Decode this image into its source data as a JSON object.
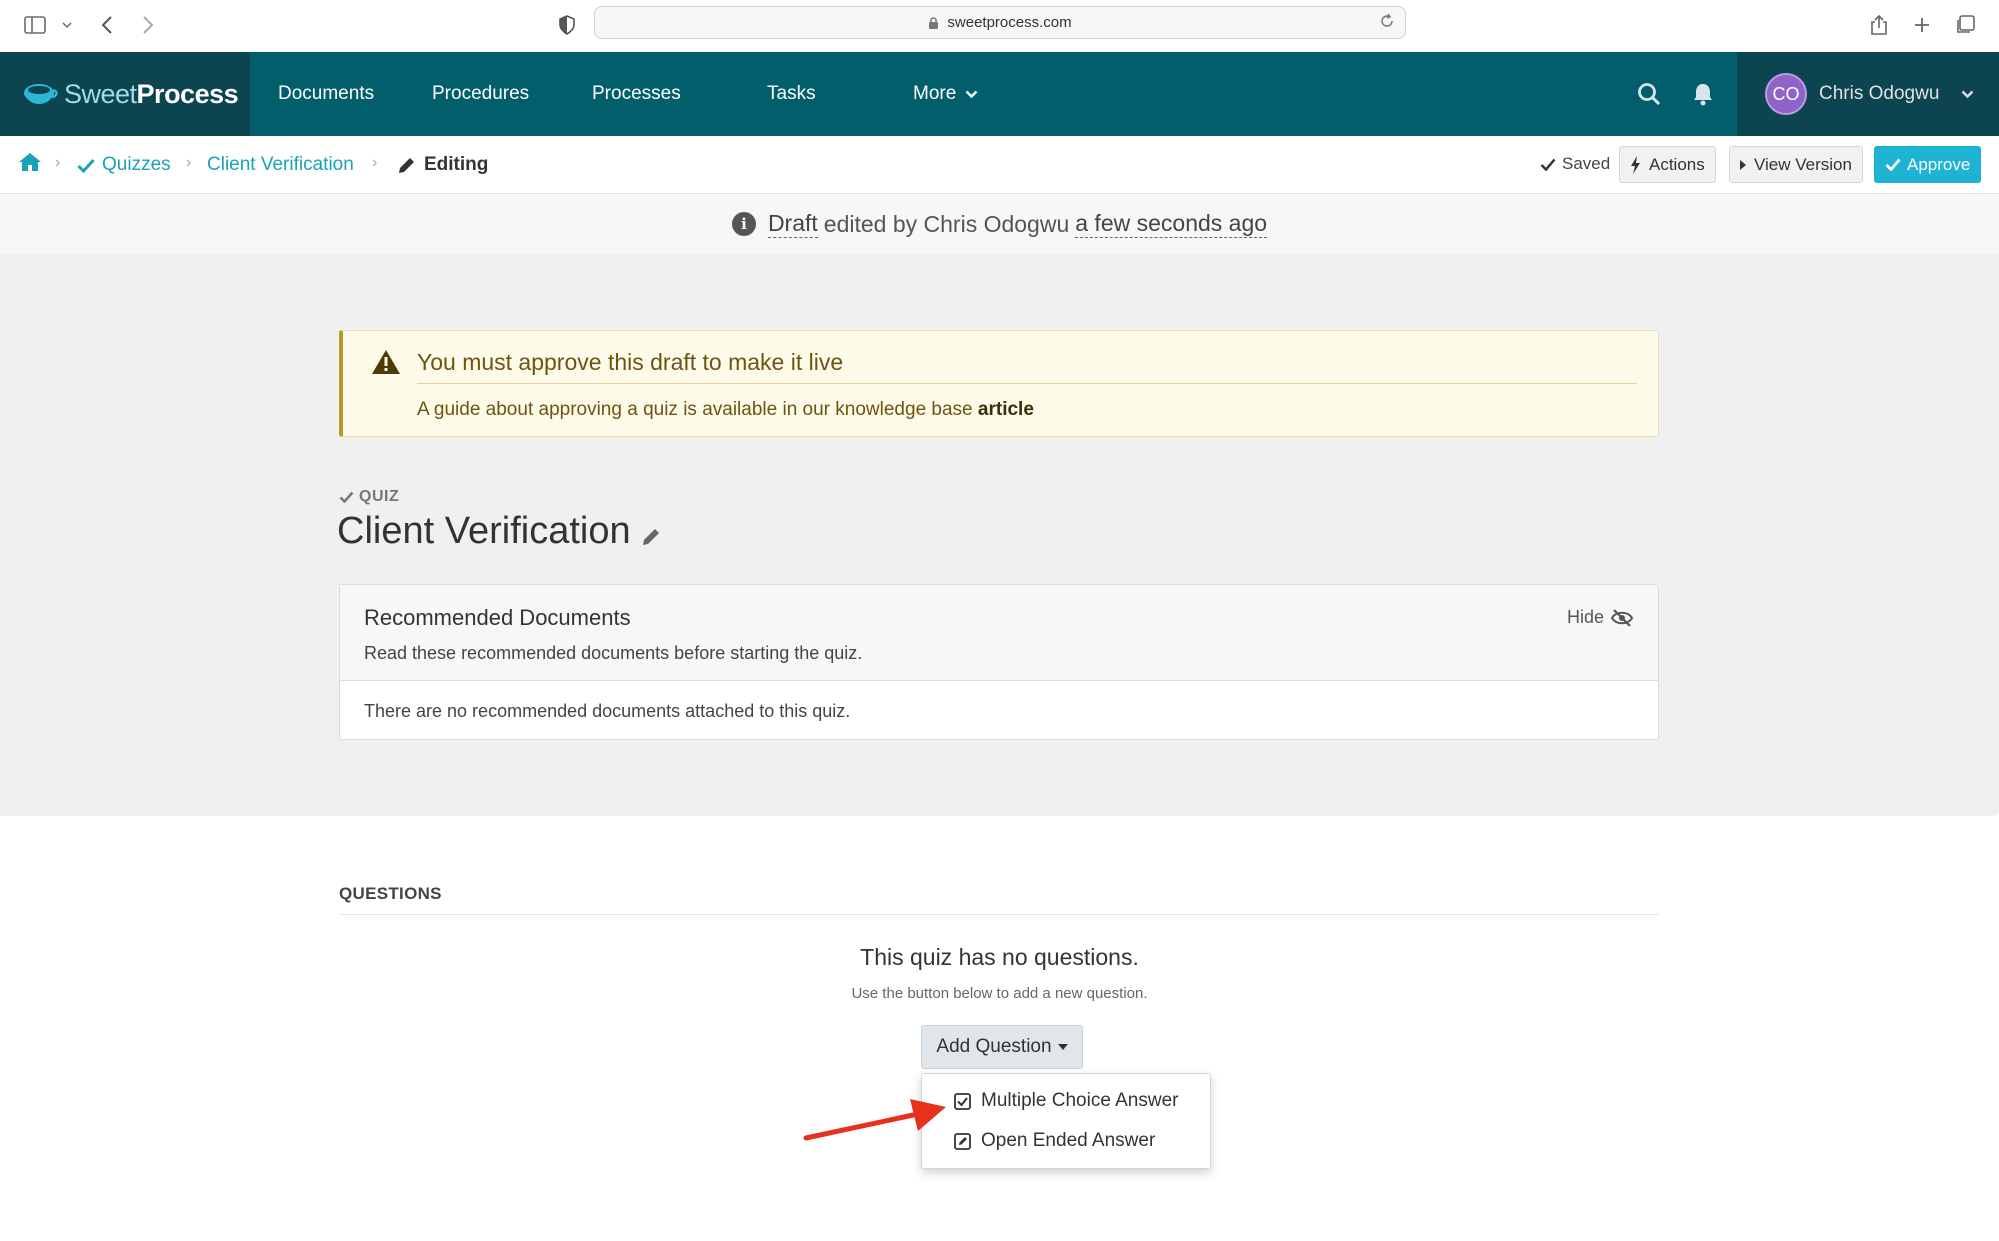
{
  "browser": {
    "url": "sweetprocess.com"
  },
  "brand": {
    "logo_light": "Sweet",
    "logo_bold": "Process",
    "nav_color": "#035e6c",
    "accent": "#1eb3d2"
  },
  "nav": {
    "items": [
      "Documents",
      "Procedures",
      "Processes",
      "Tasks",
      "More"
    ],
    "user_initials": "CO",
    "user_name": "Chris Odogwu"
  },
  "breadcrumb": {
    "quizzes": "Quizzes",
    "quiz": "Client Verification",
    "editing": "Editing"
  },
  "toolbar": {
    "saved": "Saved",
    "actions": "Actions",
    "view_version": "View Version",
    "approve": "Approve"
  },
  "draft": {
    "draft": "Draft",
    "edited_by": "edited by Chris Odogwu",
    "when": "a few seconds ago"
  },
  "alert": {
    "title": "You must approve this draft to make it live",
    "body": "A guide about approving a quiz is available in our knowledge base",
    "link": "article"
  },
  "quiz": {
    "label": "QUIZ",
    "title": "Client Verification"
  },
  "recommended": {
    "title": "Recommended Documents",
    "subtitle": "Read these recommended documents before starting the quiz.",
    "hide": "Hide",
    "empty": "There are no recommended documents attached to this quiz."
  },
  "questions": {
    "label": "QUESTIONS",
    "empty_title": "This quiz has no questions.",
    "empty_sub": "Use the button below to add a new question.",
    "add_button": "Add Question",
    "menu": [
      "Multiple Choice Answer",
      "Open Ended Answer"
    ]
  }
}
